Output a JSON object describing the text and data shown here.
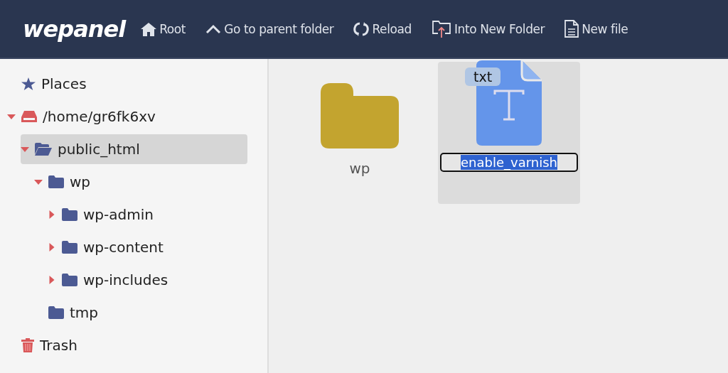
{
  "app": {
    "logo": "wepanel"
  },
  "toolbar": [
    {
      "kind": "home",
      "label": "Root"
    },
    {
      "kind": "up",
      "label": "Go to parent folder"
    },
    {
      "kind": "reload",
      "label": "Reload"
    },
    {
      "kind": "upload-folder",
      "label": "Into New Folder"
    },
    {
      "kind": "file",
      "label": "New file"
    }
  ],
  "sidebar": {
    "items": [
      {
        "kind": "places",
        "label": "Places"
      },
      {
        "kind": "drive",
        "label": "/home/gr6fk6xv",
        "expanded": true,
        "selected": false,
        "children": [
          {
            "kind": "folder",
            "label": "public_html",
            "expanded": true,
            "selected": true,
            "children": [
              {
                "kind": "folder",
                "label": "wp",
                "expanded": true,
                "selected": false,
                "children": [
                  {
                    "kind": "folder",
                    "label": "wp-admin",
                    "expanded": false,
                    "selected": false
                  },
                  {
                    "kind": "folder",
                    "label": "wp-content",
                    "expanded": false,
                    "selected": false
                  },
                  {
                    "kind": "folder",
                    "label": "wp-includes",
                    "expanded": false,
                    "selected": false
                  }
                ]
              },
              {
                "kind": "folder",
                "label": "tmp",
                "selected": false
              }
            ]
          }
        ]
      },
      {
        "kind": "trash",
        "label": "Trash"
      }
    ]
  },
  "files": [
    {
      "kind": "folder",
      "name": "wp",
      "selected": false,
      "renaming": false
    },
    {
      "kind": "txt",
      "badge": "txt",
      "name": "enable_varnish",
      "selected": true,
      "renaming": true
    }
  ]
}
